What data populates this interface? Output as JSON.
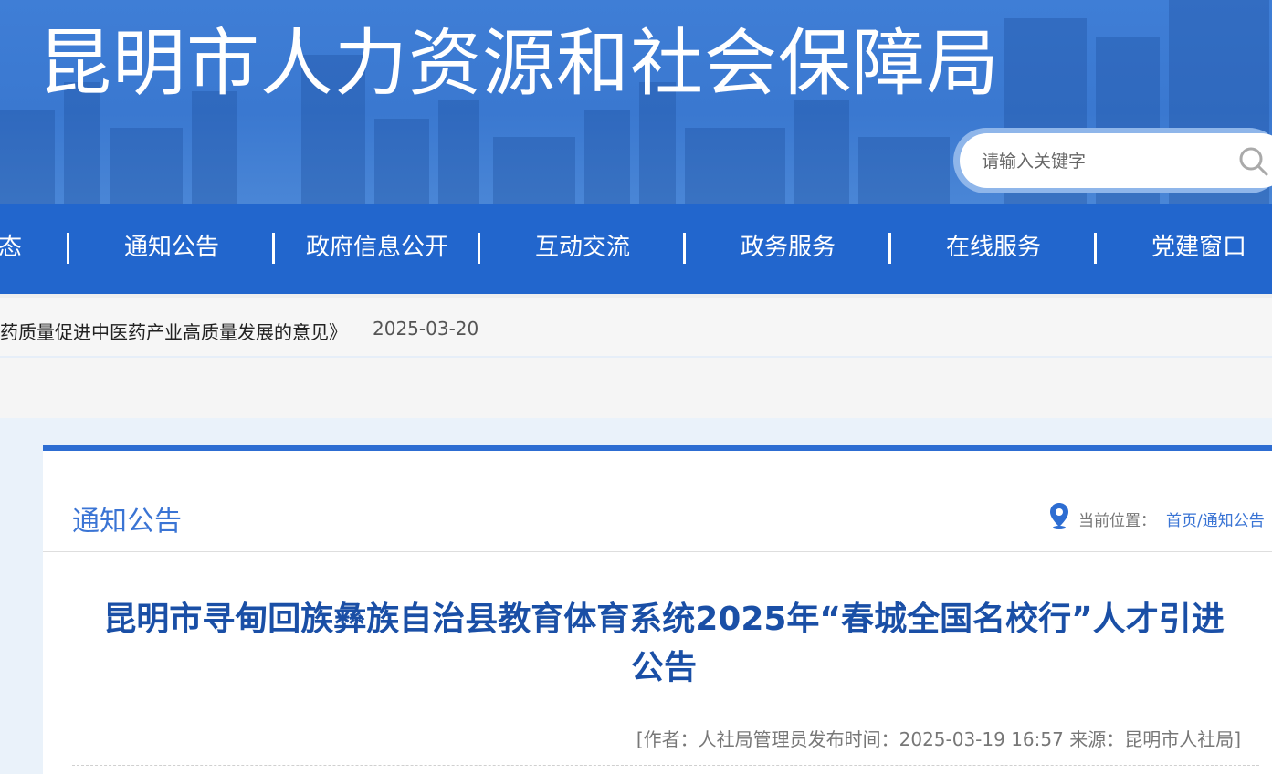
{
  "site": {
    "title": "昆明市人力资源和社会保障局"
  },
  "search": {
    "placeholder": "请输入关键字",
    "icon": "search-icon"
  },
  "nav": {
    "items": [
      {
        "label": "态"
      },
      {
        "label": "通知公告"
      },
      {
        "label": "政府信息公开"
      },
      {
        "label": "互动交流"
      },
      {
        "label": "政务服务"
      },
      {
        "label": "在线服务"
      },
      {
        "label": "党建窗口"
      }
    ]
  },
  "ticker": {
    "title": "药质量促进中医药产业高质量发展的意见》",
    "date": "2025-03-20"
  },
  "section": {
    "title": "通知公告"
  },
  "breadcrumb": {
    "label": "当前位置：",
    "path": "首页/通知公告",
    "icon": "location-pin-icon"
  },
  "article": {
    "title": "昆明市寻甸回族彝族自治县教育体育系统2025年“春城全国名校行”人才引进公告",
    "meta": "[作者：人社局管理员发布时间：2025-03-19 16:57 来源：昆明市人社局]"
  },
  "colors": {
    "banner": "#3f7ed6",
    "nav": "#2266cd",
    "accent": "#2d6dd2",
    "title_blue": "#1a4fa6",
    "link_blue": "#3a74d4"
  }
}
